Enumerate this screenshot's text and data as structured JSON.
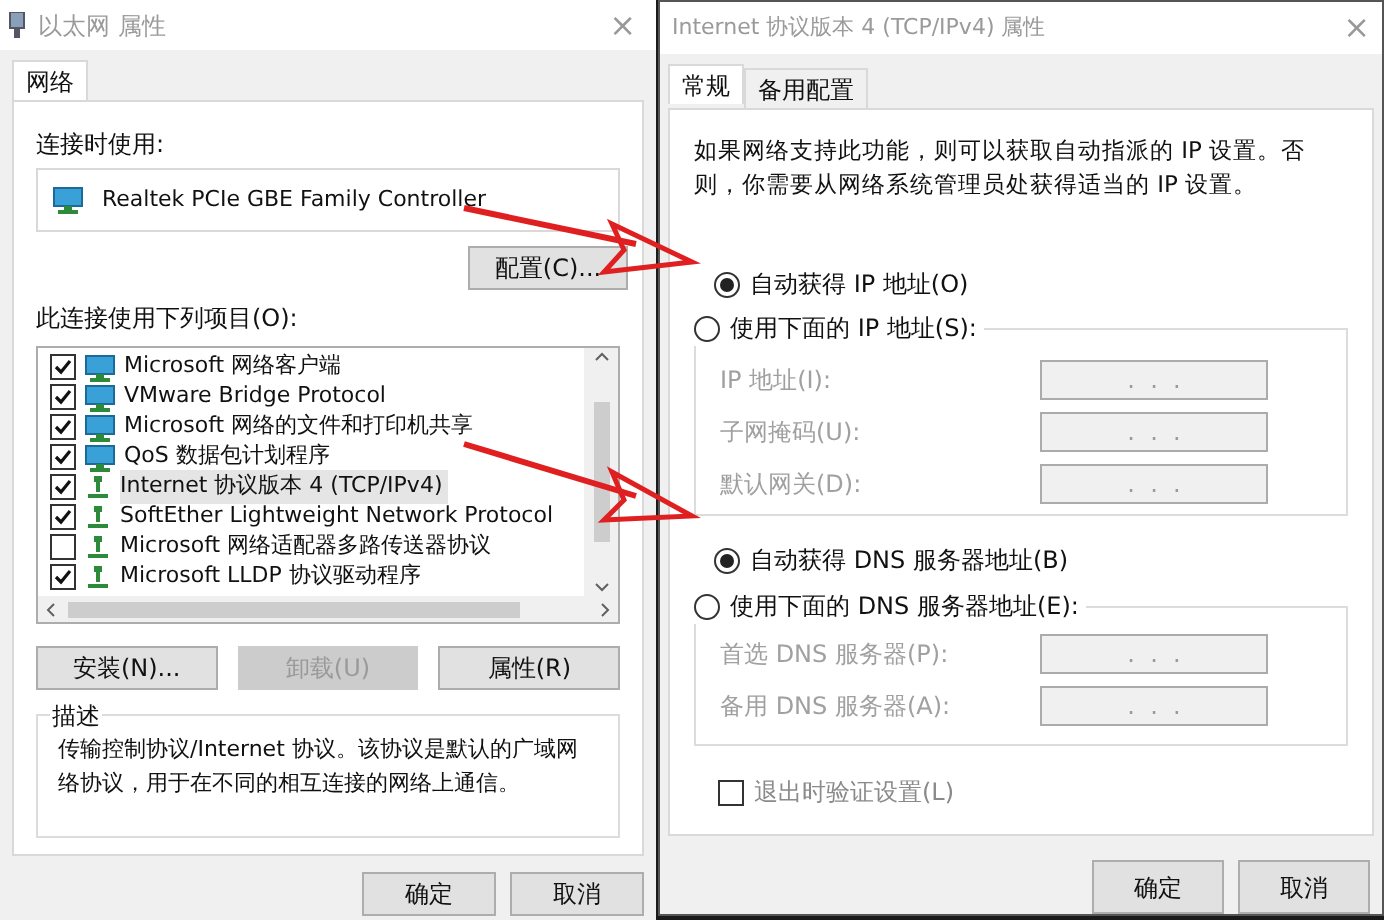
{
  "left_window": {
    "title": "以太网 属性",
    "close": "×",
    "tabs": [
      {
        "label": "网络",
        "selected": true
      }
    ],
    "connect_using_label": "连接时使用:",
    "adapter": "Realtek PCIe GBE Family Controller",
    "configure_button": "配置(C)...",
    "items_label": "此连接使用下列项目(O):",
    "items": [
      {
        "label": "Microsoft 网络客户端",
        "checked": true,
        "selected": false,
        "kind": "client"
      },
      {
        "label": "VMware Bridge Protocol",
        "checked": true,
        "selected": false,
        "kind": "client"
      },
      {
        "label": "Microsoft 网络的文件和打印机共享",
        "checked": true,
        "selected": false,
        "kind": "client"
      },
      {
        "label": "QoS 数据包计划程序",
        "checked": true,
        "selected": false,
        "kind": "client"
      },
      {
        "label": "Internet 协议版本 4 (TCP/IPv4)",
        "checked": true,
        "selected": true,
        "kind": "protocol"
      },
      {
        "label": "SoftEther Lightweight Network Protocol",
        "checked": true,
        "selected": false,
        "kind": "protocol"
      },
      {
        "label": "Microsoft 网络适配器多路传送器协议",
        "checked": false,
        "selected": false,
        "kind": "protocol"
      },
      {
        "label": "Microsoft LLDP 协议驱动程序",
        "checked": true,
        "selected": false,
        "kind": "protocol"
      }
    ],
    "buttons": [
      {
        "label": "安装(N)...",
        "disabled": false
      },
      {
        "label": "卸载(U)",
        "disabled": true
      },
      {
        "label": "属性(R)",
        "disabled": false
      }
    ],
    "description": {
      "title": "描述",
      "text": "传输控制协议/Internet 协议。该协议是默认的广域网络协议，用于在不同的相互连接的网络上通信。"
    },
    "footer_buttons": [
      "确定",
      "取消"
    ]
  },
  "right_window": {
    "title": "Internet 协议版本 4 (TCP/IPv4) 属性",
    "close": "×",
    "tabs": [
      {
        "label": "常规",
        "selected": true
      },
      {
        "label": "备用配置",
        "selected": false
      }
    ],
    "intro": "如果网络支持此功能，则可以获取自动指派的 IP 设置。否则，你需要从网络系统管理员处获得适当的 IP 设置。",
    "ip_options": [
      {
        "label": "自动获得 IP 地址(O)",
        "selected": true
      },
      {
        "label": "使用下面的 IP 地址(S):",
        "selected": false
      }
    ],
    "ip_fields": [
      {
        "label": "IP 地址(I):",
        "value": ".  .  ."
      },
      {
        "label": "子网掩码(U):",
        "value": ".  .  ."
      },
      {
        "label": "默认网关(D):",
        "value": ".  .  ."
      }
    ],
    "dns_options": [
      {
        "label": "自动获得 DNS 服务器地址(B)",
        "selected": true
      },
      {
        "label": "使用下面的 DNS 服务器地址(E):",
        "selected": false
      }
    ],
    "dns_fields": [
      {
        "label": "首选 DNS 服务器(P):",
        "value": ".  .  ."
      },
      {
        "label": "备用 DNS 服务器(A):",
        "value": ".  .  ."
      }
    ],
    "validate": {
      "label": "退出时验证设置(L)",
      "checked": false
    },
    "footer_buttons": [
      "确定",
      "取消"
    ]
  }
}
